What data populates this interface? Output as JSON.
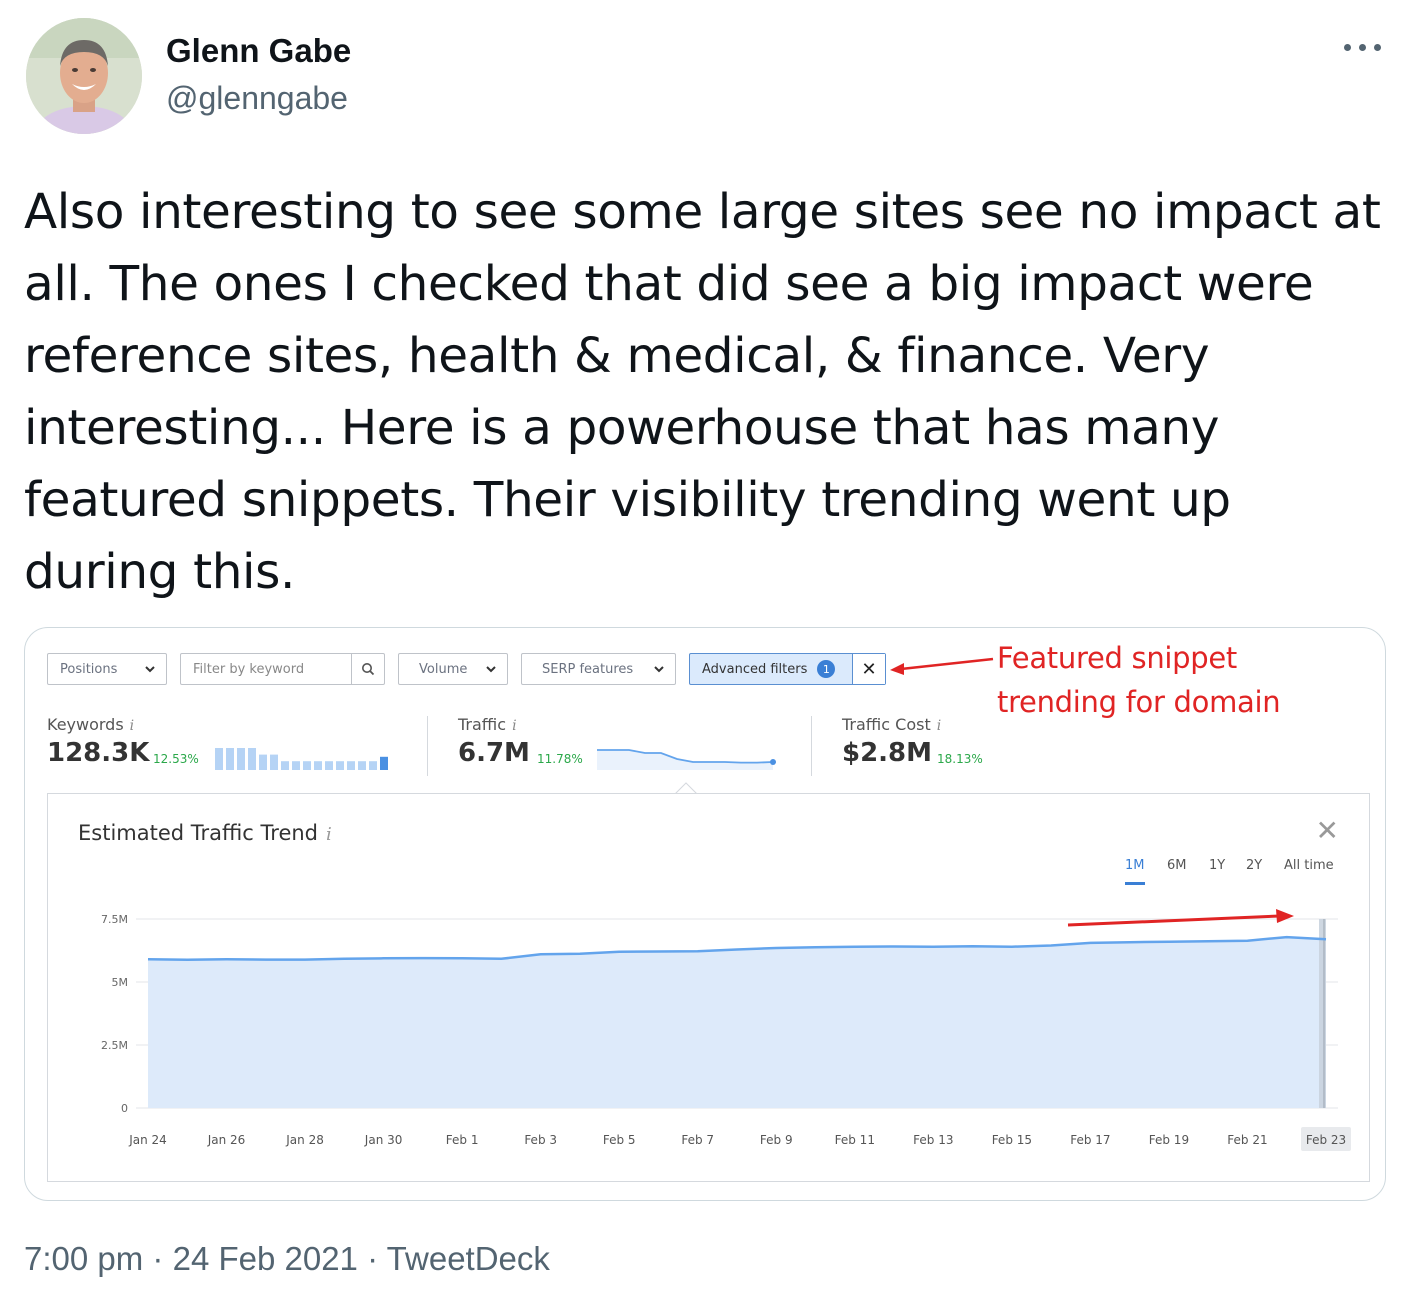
{
  "tweet": {
    "author_name": "Glenn Gabe",
    "author_handle": "@glenngabe",
    "text": "Also interesting to see some large sites see no impact at all. The ones I checked that did see a big impact were reference sites, health & medical, & finance. Very interesting... Here is a powerhouse that has many featured snippets. Their visibility trending went up during this.",
    "time": "7:00 pm",
    "separator": "·",
    "date": "24 Feb 2021",
    "client": "TweetDeck"
  },
  "screenshot": {
    "filters": {
      "positions": "Positions",
      "keyword_placeholder": "Filter by keyword",
      "volume": "Volume",
      "serp_features": "SERP features",
      "advanced": "Advanced filters",
      "advanced_count": "1"
    },
    "annotation_line1": "Featured snippet",
    "annotation_line2": "trending for domain",
    "metrics": {
      "keywords": {
        "label": "Keywords",
        "value": "128.3K",
        "pct": "12.53%"
      },
      "traffic": {
        "label": "Traffic",
        "value": "6.7M",
        "pct": "11.78%"
      },
      "traffic_cost": {
        "label": "Traffic Cost",
        "value": "$2.8M",
        "pct": "18.13%"
      }
    },
    "panel": {
      "title": "Estimated Traffic Trend",
      "ranges": [
        "1M",
        "6M",
        "1Y",
        "2Y",
        "All time"
      ],
      "active_range": "1M"
    }
  },
  "chart_data": {
    "type": "area",
    "title": "Estimated Traffic Trend",
    "x_tick_labels": [
      "Jan 24",
      "Jan 26",
      "Jan 28",
      "Jan 30",
      "Feb 1",
      "Feb 3",
      "Feb 5",
      "Feb 7",
      "Feb 9",
      "Feb 11",
      "Feb 13",
      "Feb 15",
      "Feb 17",
      "Feb 19",
      "Feb 21",
      "Feb 23"
    ],
    "y_tick_labels": [
      "0",
      "2.5M",
      "5M",
      "7.5M"
    ],
    "ylim": [
      0,
      7500000
    ],
    "x": [
      "Jan 24",
      "Jan 25",
      "Jan 26",
      "Jan 27",
      "Jan 28",
      "Jan 29",
      "Jan 30",
      "Jan 31",
      "Feb 1",
      "Feb 2",
      "Feb 3",
      "Feb 4",
      "Feb 5",
      "Feb 6",
      "Feb 7",
      "Feb 8",
      "Feb 9",
      "Feb 10",
      "Feb 11",
      "Feb 12",
      "Feb 13",
      "Feb 14",
      "Feb 15",
      "Feb 16",
      "Feb 17",
      "Feb 18",
      "Feb 19",
      "Feb 20",
      "Feb 21",
      "Feb 22",
      "Feb 23"
    ],
    "series": [
      {
        "values": [
          5900000,
          5880000,
          5900000,
          5890000,
          5890000,
          5920000,
          5940000,
          5950000,
          5940000,
          5920000,
          6100000,
          6120000,
          6200000,
          6210000,
          6220000,
          6290000,
          6350000,
          6380000,
          6400000,
          6410000,
          6400000,
          6420000,
          6400000,
          6450000,
          6550000,
          6580000,
          6600000,
          6620000,
          6640000,
          6780000,
          6700000
        ]
      }
    ],
    "keywords_spark": [
      10,
      10,
      10,
      10,
      7,
      7,
      4,
      4,
      4,
      4,
      4,
      4,
      4,
      4,
      4,
      6
    ],
    "traffic_spark": [
      6.9,
      6.9,
      6.9,
      6.85,
      6.85,
      6.75,
      6.7,
      6.7,
      6.7,
      6.69,
      6.69,
      6.7
    ],
    "highlighted_x": "Feb 23",
    "grid": true,
    "legend": "none",
    "colors": {
      "line": "#63a4ec",
      "fill": "#ddeafa",
      "annotation": "#e02424",
      "positive": "#2ba84a"
    }
  }
}
